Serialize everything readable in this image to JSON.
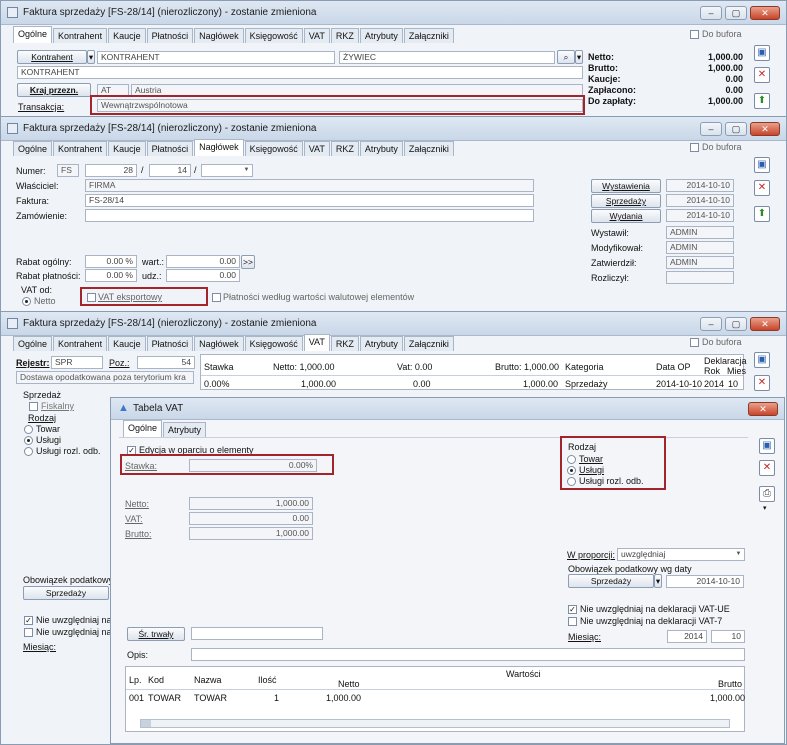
{
  "win1": {
    "title": "Faktura sprzedaży [FS-28/14] (nierozliczony) - zostanie zmieniona",
    "tabs": [
      "Ogólne",
      "Kontrahent",
      "Kaucje",
      "Płatności",
      "Nagłówek",
      "Księgowość",
      "VAT",
      "RKZ",
      "Atrybuty",
      "Załączniki"
    ],
    "do_bufora": "Do bufora",
    "kontrahent_btn": "Kontrahent",
    "kontrahent_val": "KONTRAHENT",
    "city": "ŻYWIEC",
    "kontrahent_name": "KONTRAHENT",
    "kraj_btn": "Kraj przezn.",
    "kraj_code": "AT",
    "kraj_name": "Austria",
    "transakcja_label": "Transakcja:",
    "transakcja_val": "Wewnątrzwspólnotowa",
    "sum_labels": [
      "Netto:",
      "Brutto:",
      "Kaucje:",
      "Zapłacono:",
      "Do zapłaty:"
    ],
    "sum_values": [
      "1,000.00",
      "1,000.00",
      "0.00",
      "0.00",
      "1,000.00"
    ]
  },
  "win2": {
    "title": "Faktura sprzedaży [FS-28/14] (nierozliczony) - zostanie zmieniona",
    "tabs": [
      "Ogólne",
      "Kontrahent",
      "Kaucje",
      "Płatności",
      "Nagłówek",
      "Księgowość",
      "VAT",
      "RKZ",
      "Atrybuty",
      "Załączniki"
    ],
    "do_bufora": "Do bufora",
    "numer_label": "Numer:",
    "numer_prefix": "FS",
    "numer_a": "28",
    "numer_b": "14",
    "wlasciciel_label": "Właściciel:",
    "wlasciciel_val": "FIRMA",
    "faktura_label": "Faktura:",
    "faktura_val": "FS-28/14",
    "zamowienie_label": "Zamówienie:",
    "rabat_ogolny_label": "Rabat ogólny:",
    "rabat_ogolny_val": "0.00 %",
    "wart_label": "wart.:",
    "wart_val": "0.00",
    "rabat_platnosci_label": "Rabat płatności:",
    "rabat_platnosci_val": "0.00 %",
    "udz_label": "udz.:",
    "udz_val": "0.00",
    "vat_od_label": "VAT od:",
    "netto_radio": "Netto",
    "vat_eksportowy": "VAT eksportowy",
    "platnosci_wg": "Płatności według wartości walutowej elementów",
    "date_btns": [
      "Wystawienia",
      "Sprzedaży",
      "Wydania"
    ],
    "date_vals": [
      "2014-10-10",
      "2014-10-10",
      "2014-10-10"
    ],
    "people_labels": [
      "Wystawił:",
      "Modyfikował:",
      "Zatwierdził:",
      "Rozliczył:"
    ],
    "people_vals": [
      "ADMIN",
      "ADMIN",
      "ADMIN",
      ""
    ]
  },
  "win3": {
    "title": "Faktura sprzedaży [FS-28/14] (nierozliczony) - zostanie zmieniona",
    "tabs": [
      "Ogólne",
      "Kontrahent",
      "Kaucje",
      "Płatności",
      "Nagłówek",
      "Księgowość",
      "VAT",
      "RKZ",
      "Atrybuty",
      "Załączniki"
    ],
    "do_bufora": "Do bufora",
    "rejestr_label": "Rejestr:",
    "rejestr_val": "SPR",
    "poz_label": "Poz.:",
    "poz_val": "54",
    "dostawa": "Dostawa opodatkowana poza terytorium kra",
    "sprzedaz_label": "Sprzedaż",
    "fiskalny": "Fiskalny",
    "rodzaj_label": "Rodzaj",
    "rodzaj_opts": [
      "Towar",
      "Usługi",
      "Usługi rozl. odb."
    ],
    "obowiazek_label": "Obowiązek podatkowy",
    "sprzedazy_btn": "Sprzedaży",
    "nie_uwzgl_1": "Nie uwzględniaj na d",
    "nie_uwzgl_2": "Nie uwzględniaj na g",
    "miesiac_label": "Miesiąc:",
    "grid_headers": [
      "Stawka",
      "Netto: 1,000.00",
      "Vat: 0.00",
      "Brutto: 1,000.00",
      "Kategoria",
      "Data OP",
      "Deklaracja",
      "Rok",
      "Mies"
    ],
    "grid_row": [
      "0.00%",
      "1,000.00",
      "0.00",
      "1,000.00",
      "Sprzedaży",
      "2014-10-10",
      "2014",
      "10"
    ]
  },
  "dialog": {
    "title": "Tabela VAT",
    "tabs": [
      "Ogólne",
      "Atrybuty"
    ],
    "edycja": "Edycja w oparciu o elementy",
    "stawka_label": "Stawka:",
    "stawka_val": "0.00%",
    "netto_label": "Netto:",
    "netto_val": "1,000.00",
    "vat_label": "VAT:",
    "vat_val": "0.00",
    "brutto_label": "Brutto:",
    "brutto_val": "1,000.00",
    "rodzaj_label": "Rodzaj",
    "rodzaj_opts": [
      "Towar",
      "Usługi",
      "Usługi rozl. odb."
    ],
    "w_proporcji_label": "W proporcji:",
    "w_proporcji_val": "uwzględniaj",
    "obowiazek_label": "Obowiązek podatkowy wg daty",
    "sprzedazy_btn": "Sprzedaży",
    "obowiazek_date": "2014-10-10",
    "nie_uwzgl_vatue": "Nie uwzględniaj na deklaracji VAT-UE",
    "nie_uwzgl_vat7": "Nie uwzględniaj na deklaracji VAT-7",
    "miesiac_label": "Miesiąc:",
    "miesiac_rok": "2014",
    "miesiac_mc": "10",
    "sr_trwaly_btn": "Śr. trwały",
    "opis_label": "Opis:",
    "table_headers": [
      "Lp.",
      "Kod",
      "Nazwa",
      "Ilość",
      "Wartości",
      "Netto",
      "Brutto"
    ],
    "table_row": [
      "001",
      "TOWAR",
      "TOWAR",
      "1",
      "1,000.00",
      "1,000.00"
    ]
  },
  "colors": {
    "highlight": "#a3242a",
    "titlebar": "#c9d7e8"
  }
}
